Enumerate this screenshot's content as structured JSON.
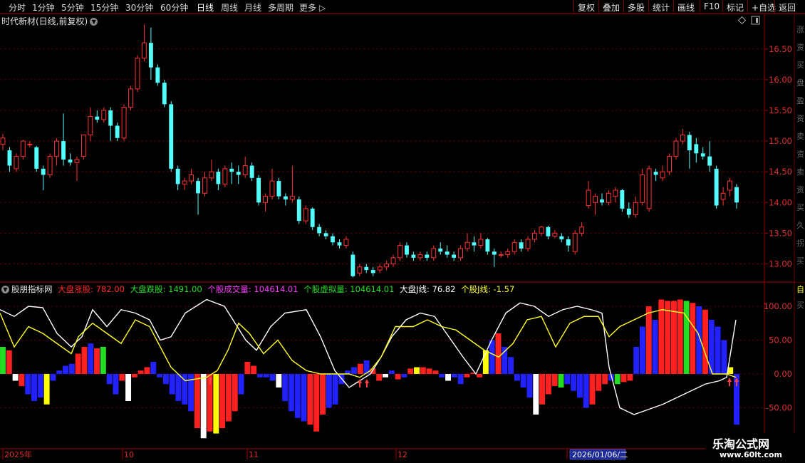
{
  "toolbar": {
    "periods": [
      {
        "label": "分时",
        "x": 14
      },
      {
        "label": "1分钟",
        "x": 47
      },
      {
        "label": "5分钟",
        "x": 88
      },
      {
        "label": "15分钟",
        "x": 129
      },
      {
        "label": "30分钟",
        "x": 178
      },
      {
        "label": "60分钟",
        "x": 227
      },
      {
        "label": "日线",
        "x": 278
      },
      {
        "label": "周线",
        "x": 312
      },
      {
        "label": "月线",
        "x": 345
      },
      {
        "label": "多周期",
        "x": 378
      },
      {
        "label": "更多",
        "x": 422
      }
    ],
    "more_arrow": "▷",
    "actions": [
      "复权",
      "叠加",
      "多股",
      "统计",
      "画线",
      "F10",
      "标记",
      "+自选",
      "返回"
    ]
  },
  "title": {
    "stock": "时代新材(日线,前复权)",
    "dropdown_icon": "chevron-down-icon"
  },
  "indicator": {
    "name": "股朋指标网",
    "items": [
      {
        "label": "大盘涨股: 782.00",
        "color": "#ff2a2a"
      },
      {
        "label": "大盘跌股: 1491.00",
        "color": "#27e027"
      },
      {
        "label": "个股成交量: 104614.01",
        "color": "#ff3cff"
      },
      {
        "label": "个股虚拟量: 104614.01",
        "color": "#27e027"
      },
      {
        "label": "大盘J线: 76.82",
        "color": "#ffffff"
      },
      {
        "label": "个股J线: -1.57",
        "color": "#ffff33"
      }
    ]
  },
  "price_axis": [
    "16.50",
    "16.00",
    "15.50",
    "15.00",
    "14.50",
    "14.00",
    "13.50",
    "13.00"
  ],
  "ind_axis": [
    "100.00",
    "50.00",
    "0.00",
    "-50.00"
  ],
  "date_axis": [
    "2025年",
    "10",
    "11",
    "12",
    "1"
  ],
  "cursor_date": "2026/01/06/二",
  "watermark": {
    "line1": "乐淘公式网",
    "line2": "www.60lt.com"
  },
  "chart_data": {
    "type": "candlestick",
    "ylim": [
      12.75,
      16.95
    ],
    "candles": [
      [
        14.95,
        15.05,
        14.85,
        15.12
      ],
      [
        14.85,
        14.6,
        14.5,
        14.9
      ],
      [
        14.55,
        14.75,
        14.5,
        14.8
      ],
      [
        14.75,
        15.0,
        14.7,
        15.02
      ],
      [
        14.95,
        14.95,
        14.9,
        15.0
      ],
      [
        14.9,
        14.55,
        14.5,
        14.92
      ],
      [
        14.55,
        14.45,
        14.2,
        14.6
      ],
      [
        14.45,
        14.75,
        14.4,
        14.8
      ],
      [
        14.75,
        15.0,
        14.6,
        15.05
      ],
      [
        15.0,
        14.7,
        14.6,
        15.45
      ],
      [
        14.7,
        14.65,
        14.6,
        14.8
      ],
      [
        14.65,
        14.7,
        14.35,
        14.75
      ],
      [
        14.75,
        15.1,
        14.7,
        15.1
      ],
      [
        15.1,
        15.4,
        15.0,
        15.55
      ],
      [
        15.4,
        15.35,
        15.3,
        15.5
      ],
      [
        15.35,
        15.5,
        15.3,
        15.55
      ],
      [
        15.5,
        15.25,
        15.0,
        15.55
      ],
      [
        15.25,
        15.05,
        15.0,
        15.3
      ],
      [
        15.05,
        15.55,
        15.0,
        15.6
      ],
      [
        15.55,
        15.85,
        15.5,
        15.9
      ],
      [
        15.85,
        16.35,
        15.8,
        16.4
      ],
      [
        16.35,
        16.6,
        16.3,
        16.9
      ],
      [
        16.6,
        16.2,
        16.0,
        16.85
      ],
      [
        16.2,
        15.95,
        15.9,
        16.25
      ],
      [
        15.95,
        15.6,
        15.55,
        16.0
      ],
      [
        15.6,
        14.55,
        14.5,
        15.65
      ],
      [
        14.55,
        14.3,
        14.2,
        14.6
      ],
      [
        14.3,
        14.35,
        14.2,
        14.4
      ],
      [
        14.35,
        14.45,
        14.3,
        14.55
      ],
      [
        14.35,
        14.15,
        13.8,
        14.4
      ],
      [
        14.15,
        14.4,
        14.1,
        14.5
      ],
      [
        14.4,
        14.5,
        14.35,
        14.7
      ],
      [
        14.5,
        14.3,
        14.2,
        14.55
      ],
      [
        14.3,
        14.55,
        14.25,
        14.6
      ],
      [
        14.55,
        14.5,
        14.3,
        14.65
      ],
      [
        14.5,
        14.45,
        14.3,
        14.6
      ],
      [
        14.45,
        14.6,
        14.4,
        14.75
      ],
      [
        14.6,
        14.4,
        14.35,
        14.65
      ],
      [
        14.4,
        14.0,
        13.95,
        14.45
      ],
      [
        14.0,
        14.1,
        13.85,
        14.15
      ],
      [
        14.1,
        14.35,
        14.05,
        14.55
      ],
      [
        14.35,
        14.1,
        14.05,
        14.4
      ],
      [
        14.1,
        14.05,
        13.95,
        14.15
      ],
      [
        14.05,
        14.1,
        14.0,
        14.6
      ],
      [
        14.05,
        13.7,
        13.65,
        14.1
      ],
      [
        13.7,
        13.9,
        13.65,
        13.95
      ],
      [
        13.9,
        13.6,
        13.55,
        13.92
      ],
      [
        13.6,
        13.5,
        13.45,
        13.65
      ],
      [
        13.5,
        13.45,
        13.4,
        13.55
      ],
      [
        13.45,
        13.35,
        13.3,
        13.5
      ],
      [
        13.35,
        13.3,
        13.25,
        13.4
      ],
      [
        13.3,
        13.4,
        13.25,
        13.45
      ],
      [
        13.15,
        12.8,
        12.78,
        13.2
      ],
      [
        12.85,
        12.95,
        12.8,
        13.0
      ],
      [
        12.95,
        12.9,
        12.85,
        13.0
      ],
      [
        12.9,
        12.85,
        12.8,
        12.95
      ],
      [
        12.9,
        12.95,
        12.85,
        13.0
      ],
      [
        12.95,
        13.0,
        12.9,
        13.05
      ],
      [
        13.0,
        13.1,
        12.95,
        13.15
      ],
      [
        13.1,
        13.3,
        13.05,
        13.35
      ],
      [
        13.3,
        13.15,
        13.1,
        13.35
      ],
      [
        13.15,
        13.1,
        13.05,
        13.2
      ],
      [
        13.1,
        13.15,
        13.05,
        13.2
      ],
      [
        13.15,
        13.1,
        13.05,
        13.2
      ],
      [
        13.1,
        13.25,
        13.05,
        13.3
      ],
      [
        13.25,
        13.2,
        13.15,
        13.35
      ],
      [
        13.2,
        13.15,
        13.1,
        13.3
      ],
      [
        13.15,
        13.1,
        13.05,
        13.2
      ],
      [
        13.1,
        13.25,
        13.05,
        13.3
      ],
      [
        13.25,
        13.35,
        13.2,
        13.5
      ],
      [
        13.35,
        13.3,
        13.2,
        13.45
      ],
      [
        13.3,
        13.4,
        13.25,
        13.5
      ],
      [
        13.4,
        13.2,
        13.15,
        13.42
      ],
      [
        13.2,
        13.15,
        12.95,
        13.25
      ],
      [
        13.15,
        13.15,
        13.1,
        13.2
      ],
      [
        13.15,
        13.2,
        13.1,
        13.25
      ],
      [
        13.2,
        13.35,
        13.15,
        13.4
      ],
      [
        13.35,
        13.25,
        13.2,
        13.4
      ],
      [
        13.25,
        13.4,
        13.2,
        13.45
      ],
      [
        13.4,
        13.5,
        13.35,
        13.55
      ],
      [
        13.5,
        13.6,
        13.45,
        13.62
      ],
      [
        13.6,
        13.45,
        13.4,
        13.62
      ],
      [
        13.45,
        13.5,
        13.42,
        13.55
      ],
      [
        13.45,
        13.4,
        13.35,
        13.5
      ],
      [
        13.4,
        13.3,
        13.2,
        13.45
      ],
      [
        13.2,
        13.5,
        13.15,
        13.55
      ],
      [
        13.5,
        13.6,
        13.45,
        13.68
      ],
      [
        13.95,
        14.2,
        13.9,
        14.35
      ],
      [
        14.0,
        14.1,
        13.8,
        14.15
      ],
      [
        14.05,
        14.0,
        13.95,
        14.15
      ],
      [
        14.0,
        14.15,
        13.95,
        14.2
      ],
      [
        14.1,
        14.2,
        14.0,
        14.25
      ],
      [
        14.2,
        13.9,
        13.85,
        14.22
      ],
      [
        13.9,
        13.8,
        13.75,
        14.0
      ],
      [
        13.8,
        14.0,
        13.75,
        14.1
      ],
      [
        14.0,
        14.45,
        13.95,
        14.55
      ],
      [
        13.9,
        14.55,
        13.85,
        14.6
      ],
      [
        14.5,
        14.45,
        14.35,
        14.55
      ],
      [
        14.4,
        14.5,
        14.35,
        14.6
      ],
      [
        14.5,
        14.75,
        14.45,
        14.8
      ],
      [
        14.75,
        15.0,
        14.7,
        15.05
      ],
      [
        15.0,
        15.1,
        14.95,
        15.2
      ],
      [
        15.1,
        14.85,
        14.55,
        15.15
      ],
      [
        14.95,
        14.8,
        14.65,
        15.05
      ],
      [
        14.8,
        14.75,
        14.7,
        14.9
      ],
      [
        14.75,
        14.6,
        14.5,
        15.0
      ],
      [
        14.55,
        13.95,
        13.9,
        14.6
      ],
      [
        14.05,
        14.15,
        13.95,
        14.25
      ],
      [
        14.2,
        14.35,
        14.1,
        14.4
      ],
      [
        14.25,
        14.0,
        13.9,
        14.3
      ]
    ]
  }
}
